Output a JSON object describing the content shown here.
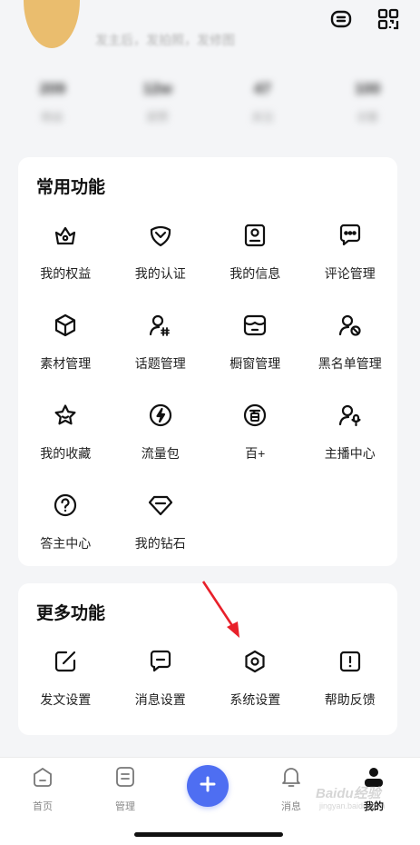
{
  "header": {
    "icons": [
      "subtitle-icon",
      "qr-scan-icon"
    ],
    "profile_description": "发主后，发拍照，发修图"
  },
  "stats": [
    {
      "value": "209",
      "label": "粉丝"
    },
    {
      "value": "12w",
      "label": "获赞"
    },
    {
      "value": "47",
      "label": "关注"
    },
    {
      "value": "100",
      "label": "访客"
    }
  ],
  "common_functions": {
    "title": "常用功能",
    "items": [
      {
        "label": "我的权益",
        "icon": "crown-icon"
      },
      {
        "label": "我的认证",
        "icon": "verified-badge-icon"
      },
      {
        "label": "我的信息",
        "icon": "user-card-icon"
      },
      {
        "label": "评论管理",
        "icon": "comment-icon"
      },
      {
        "label": "素材管理",
        "icon": "cube-icon"
      },
      {
        "label": "话题管理",
        "icon": "topic-icon"
      },
      {
        "label": "橱窗管理",
        "icon": "storefront-icon"
      },
      {
        "label": "黑名单管理",
        "icon": "block-user-icon"
      },
      {
        "label": "我的收藏",
        "icon": "star-icon"
      },
      {
        "label": "流量包",
        "icon": "lightning-icon"
      },
      {
        "label": "百+",
        "icon": "bai-plus-icon"
      },
      {
        "label": "主播中心",
        "icon": "host-mic-icon"
      },
      {
        "label": "答主中心",
        "icon": "question-icon"
      },
      {
        "label": "我的钻石",
        "icon": "diamond-icon"
      }
    ]
  },
  "more_functions": {
    "title": "更多功能",
    "items": [
      {
        "label": "发文设置",
        "icon": "edit-icon"
      },
      {
        "label": "消息设置",
        "icon": "message-icon"
      },
      {
        "label": "系统设置",
        "icon": "settings-hex-icon"
      },
      {
        "label": "帮助反馈",
        "icon": "feedback-icon"
      }
    ]
  },
  "tabbar": {
    "tabs": [
      {
        "label": "首页",
        "icon": "home-icon"
      },
      {
        "label": "管理",
        "icon": "manage-icon"
      },
      {
        "label": "消息",
        "icon": "bell-icon"
      },
      {
        "label": "我的",
        "icon": "profile-icon"
      }
    ],
    "active_tab": "我的",
    "plus_icon": "plus-icon"
  },
  "watermark": {
    "main": "Baidu经验",
    "sub": "jingyan.baidu.com"
  },
  "colors": {
    "background": "#f4f5f7",
    "card": "#ffffff",
    "accent_blue": "#4e6ef2",
    "annotation_arrow": "#e8202a",
    "avatar": "#e9b75e"
  }
}
